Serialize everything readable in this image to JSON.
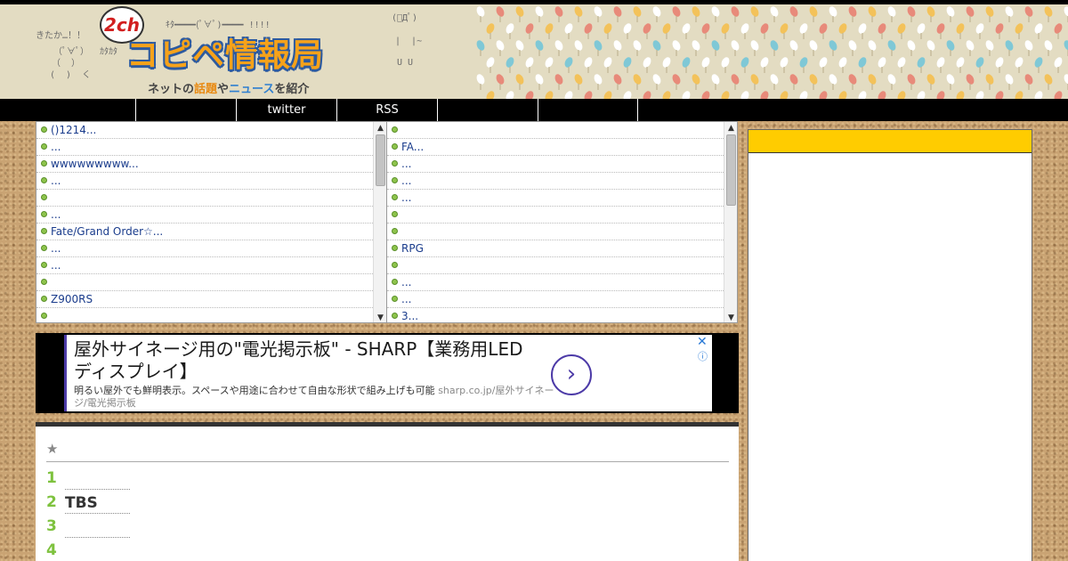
{
  "site": {
    "logo_badge": "2ch",
    "title": "コピペ情報局",
    "subtitle_pre": "ネットの",
    "subtitle_a": "話題",
    "subtitle_mid": "や",
    "subtitle_b": "ニュース",
    "subtitle_post": "を紹介",
    "ascii_art": {
      "left_1": "きたか…！！",
      "left_2": "（ﾟ∀ﾟ）  ｶﾀｶﾀ",
      "left_3": "（  ）",
      "left_4": "(  )  く",
      "top": "ｷﾀ━━━━(ﾟ∀ﾟ)━━━━ !!!!",
      "right_1": "(ﾟДﾟ)",
      "right_2": "|  |~",
      "right_3": "U U"
    }
  },
  "nav": {
    "items": [
      "",
      "",
      "twitter",
      "RSS",
      "",
      ""
    ]
  },
  "feed_left": {
    "items": [
      "()1214...",
      "...",
      "wwwwwwwww...",
      "...",
      "",
      "...",
      "Fate/Grand Order☆...",
      "...",
      "...",
      "",
      "Z900RS",
      ""
    ]
  },
  "feed_right": {
    "items": [
      "",
      "FA...",
      "  ...",
      "...",
      "...",
      "",
      "",
      "RPG",
      "",
      "...",
      "  ...",
      "3..."
    ]
  },
  "ad": {
    "title": "屋外サイネージ用の\"電光掲示板\" - SHARP【業務用LEDディスプレイ】",
    "description": "明るい屋外でも鮮明表示。スペースや用途に合わせて自由な形状で組み上げも可能",
    "url": "sharp.co.jp/屋外サイネージ/電光掲示板",
    "arrow_icon": "chevron-right",
    "close_icon": "close-x",
    "info_icon": "info-i",
    "accent_color": "#4c3aa7"
  },
  "ranking": {
    "star": "★",
    "items": [
      {
        "num": "1",
        "text": ""
      },
      {
        "num": "2",
        "text": "TBS"
      },
      {
        "num": "3",
        "text": ""
      },
      {
        "num": "4",
        "text": ""
      }
    ]
  },
  "colors": {
    "sidebar_header": "#ffcc00",
    "rank_number": "#7ec23e",
    "link": "#1a3c8c"
  }
}
